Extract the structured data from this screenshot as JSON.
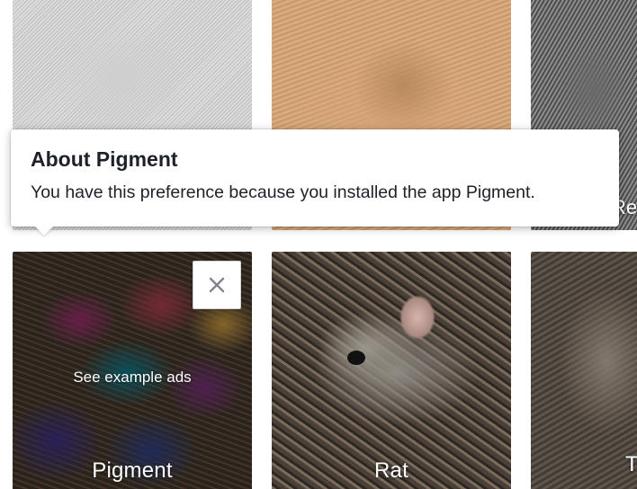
{
  "tooltip": {
    "title": "About Pigment",
    "body": "You have this preference because you installed the app Pigment."
  },
  "tiles": {
    "top_right_peek": "Re",
    "pigment": {
      "label": "Pigment",
      "hover_action": "See example ads",
      "close_icon": "close-icon"
    },
    "rat": {
      "label": "Rat"
    },
    "bottom_right_peek": "T"
  }
}
